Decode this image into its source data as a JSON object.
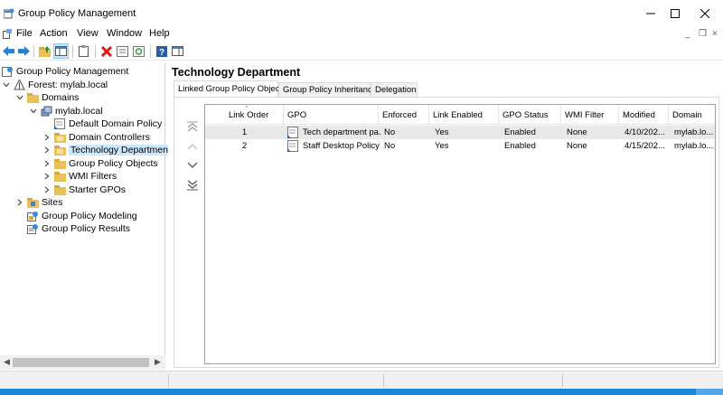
{
  "window": {
    "title": "Group Policy Management",
    "controls": [
      "minimize",
      "maximize",
      "close"
    ]
  },
  "menu": {
    "items": [
      "File",
      "Action",
      "View",
      "Window",
      "Help"
    ],
    "mdi_controls": [
      "_",
      "❒",
      "×"
    ]
  },
  "toolbar": {
    "buttons": [
      "back-icon",
      "forward-icon",
      "up-folder-icon",
      "show-hide-tree-icon",
      "copy-icon",
      "delete-icon",
      "properties-icon",
      "refresh-icon",
      "help-icon",
      "action-pane-icon"
    ]
  },
  "tree": {
    "root": "Group Policy Management",
    "forest": "Forest: mylab.local",
    "domains": "Domains",
    "domain": "mylab.local",
    "items": [
      "Default Domain Policy",
      "Domain Controllers",
      "Technology Department",
      "Group Policy Objects",
      "WMI Filters",
      "Starter GPOs"
    ],
    "sites": "Sites",
    "modeling": "Group Policy Modeling",
    "results": "Group Policy Results",
    "selected": "Technology Department"
  },
  "details": {
    "title": "Technology Department",
    "tabs": [
      "Linked Group Policy Objects",
      "Group Policy Inheritance",
      "Delegation"
    ],
    "active_tab": "Linked Group Policy Objects",
    "columns": [
      "Link Order",
      "GPO",
      "Enforced",
      "Link Enabled",
      "GPO Status",
      "WMI Filter",
      "Modified",
      "Domain"
    ],
    "rows": [
      {
        "order": "1",
        "gpo": "Tech department pa...",
        "enforced": "No",
        "link_enabled": "Yes",
        "status": "Enabled",
        "wmi": "None",
        "modified": "4/10/202...",
        "domain": "mylab.lo..."
      },
      {
        "order": "2",
        "gpo": "Staff Desktop Policy",
        "enforced": "No",
        "link_enabled": "Yes",
        "status": "Enabled",
        "wmi": "None",
        "modified": "4/15/202...",
        "domain": "mylab.lo..."
      }
    ]
  },
  "colors": {
    "selection": "#cce8ff",
    "row_highlight": "#e8e8e8",
    "taskbar": "#1e88d8",
    "folder": "#e8c15a"
  }
}
